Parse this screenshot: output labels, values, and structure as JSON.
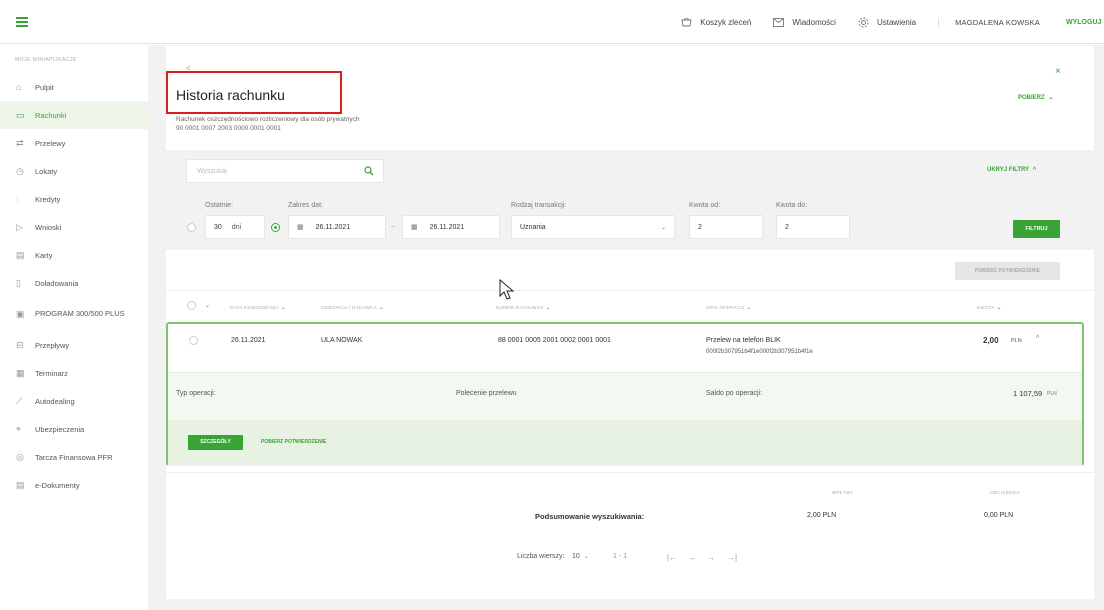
{
  "topbar": {
    "cart": "Koszyk zleceń",
    "messages": "Wiadomości",
    "settings": "Ustawienia",
    "user": "MAGDALENA KOWSKA",
    "logout": "WYLOGUJ"
  },
  "sidebar": {
    "section": "MOJE MINIAPLIKACJE",
    "items": [
      {
        "label": "Pulpit",
        "icon": "dashboard-icon"
      },
      {
        "label": "Rachunki",
        "icon": "accounts-icon",
        "active": true
      },
      {
        "label": "Przelewy",
        "icon": "transfers-icon"
      },
      {
        "label": "Lokaty",
        "icon": "deposits-icon"
      },
      {
        "label": "Kredyty",
        "icon": "credits-icon"
      },
      {
        "label": "Wnioski",
        "icon": "applications-icon"
      },
      {
        "label": "Karty",
        "icon": "cards-icon"
      },
      {
        "label": "Doładowania",
        "icon": "topup-icon"
      },
      {
        "label": "PROGRAM 300/500 PLUS",
        "icon": "program-icon"
      },
      {
        "label": "Przepływy",
        "icon": "flows-icon"
      },
      {
        "label": "Terminarz",
        "icon": "calendar-icon"
      },
      {
        "label": "Autodealing",
        "icon": "chart-icon"
      },
      {
        "label": "Ubezpieczenia",
        "icon": "insurance-icon"
      },
      {
        "label": "Tarcza Finansowa PFR",
        "icon": "shield-icon"
      },
      {
        "label": "e-Dokumenty",
        "icon": "documents-icon"
      }
    ]
  },
  "page": {
    "back": "<",
    "title": "Historia rachunku",
    "account_type": "Rachunek oszczędnościowo rozliczeniowy dla osób prywatnych",
    "account_number": "90 0001 0007 2003 0000 0001 0001",
    "close": "×",
    "download": "POBIERZ"
  },
  "filters": {
    "search_placeholder": "Wyszukaj",
    "hide_filters": "UKRYJ FILTRY",
    "last_label": "Ostatnie:",
    "last_value": "30",
    "last_unit": "dni",
    "range_label": "Zakres dat:",
    "date_from": "26.11.2021",
    "date_sep": "–",
    "date_to": "26.11.2021",
    "type_label": "Rodzaj transakcji:",
    "type_value": "Uznania",
    "amount_from_label": "Kwota od:",
    "amount_from": "2",
    "amount_to_label": "Kwota do:",
    "amount_to": "2",
    "apply": "FILTRUJ"
  },
  "table": {
    "download_confirmations": "POBIERZ POTWIERDZENIE",
    "headers": {
      "date": "DATA KSIĘGOWANIA",
      "party": "ODBIORCA / NADAWCA",
      "account": "NUMER RACHUNKU",
      "desc": "OPIS OPERACJI",
      "amount": "KWOTA"
    },
    "row": {
      "date": "26.11.2021",
      "party": "ULA NOWAK",
      "account": "88 0001 0005 2001 0002 0001 0001",
      "desc1": "Przelew na telefon BLIK",
      "desc2": "000f2b307951b4f1e000f2b307951b4f1e",
      "amount": "2,00",
      "currency": "PLN",
      "type_label": "Typ operacji:",
      "type_value": "Polecenie przelewu",
      "balance_label": "Saldo po operacji:",
      "balance_value": "1 107,59",
      "balance_currency": "PLN",
      "details": "SZCZEGÓŁY",
      "confirm": "POBIERZ POTWIERDZENIE"
    }
  },
  "summary": {
    "label": "Podsumowanie wyszukiwania:",
    "in_header": "WPŁYWY",
    "in_value": "2,00 PLN",
    "out_header": "OBCIĄŻENIA",
    "out_value": "0,00 PLN"
  },
  "pager": {
    "rows_label": "Liczba wierszy:",
    "rows_value": "10",
    "range": "1 - 1"
  },
  "colors": {
    "accent": "#3aa335",
    "highlight": "#d42020"
  }
}
